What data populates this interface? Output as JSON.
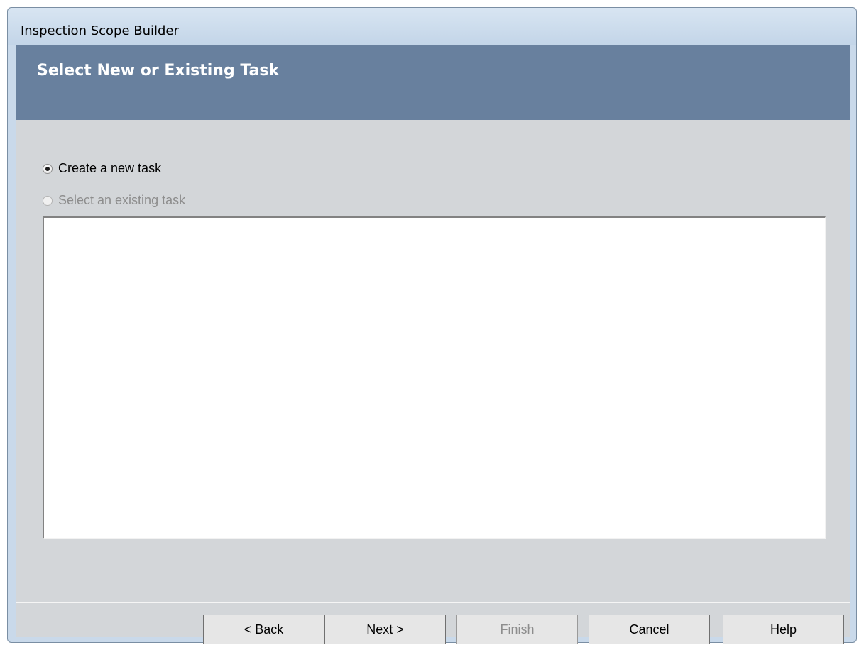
{
  "window": {
    "title": "Inspection Scope Builder"
  },
  "banner": {
    "title": "Select New or Existing Task"
  },
  "options": {
    "create_new": {
      "label": "Create a new task",
      "checked": true,
      "enabled": true
    },
    "select_existing": {
      "label": "Select an existing task",
      "checked": false,
      "enabled": false
    }
  },
  "buttons": {
    "back": "< Back",
    "next": "Next >",
    "finish": "Finish",
    "cancel": "Cancel",
    "help": "Help"
  },
  "colors": {
    "banner": "#68809e",
    "client": "#d3d6d9",
    "disabled_text": "#8d8d8d"
  }
}
